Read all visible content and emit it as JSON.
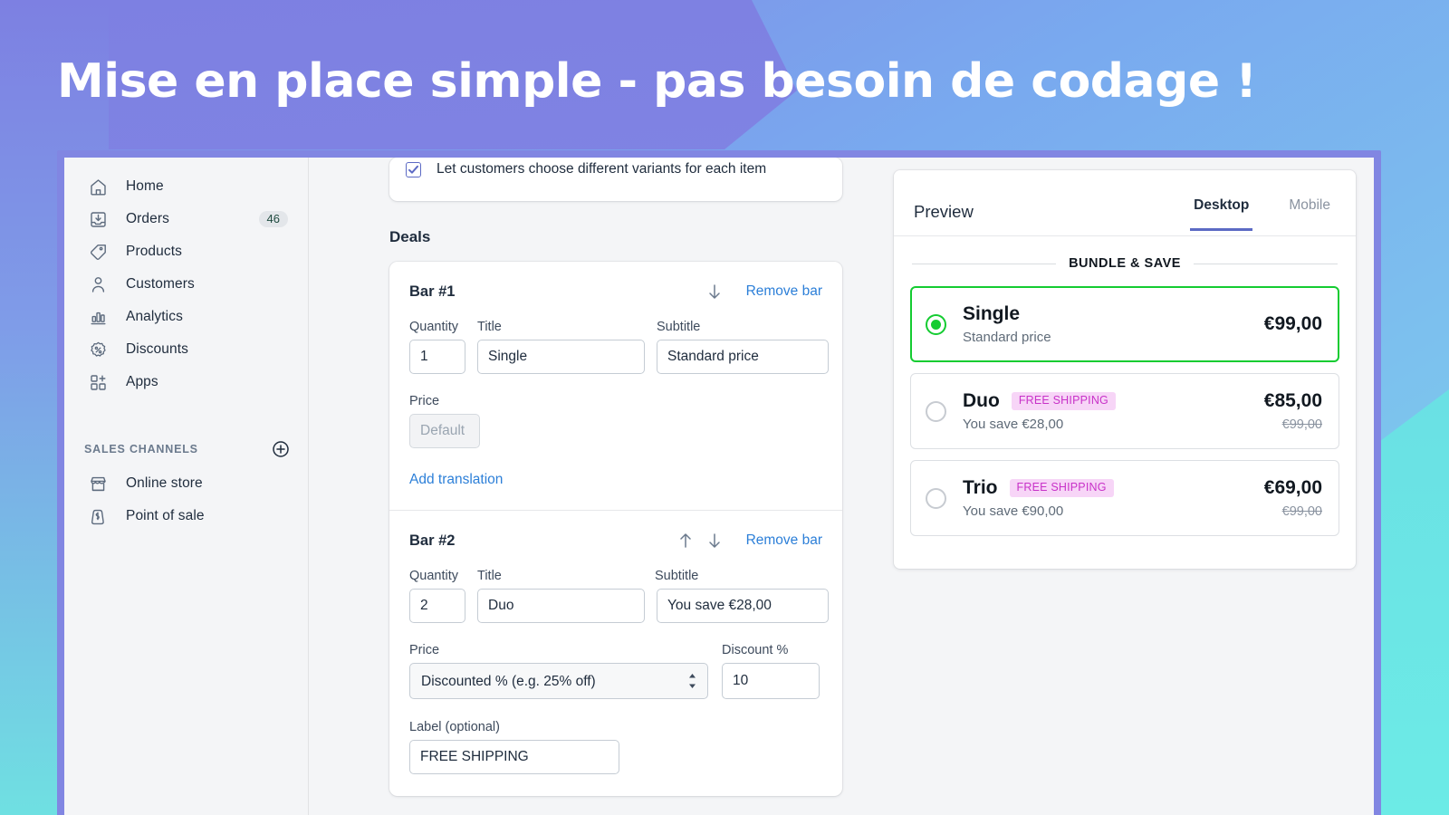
{
  "banner": {
    "headline": "Mise en place simple - pas besoin de codage !",
    "colors": {
      "purple": "#8186e2",
      "blue": "#7db0ee",
      "teal": "#6cebe6"
    }
  },
  "sidebar": {
    "items": [
      {
        "label": "Home",
        "icon": "home-icon",
        "badge": ""
      },
      {
        "label": "Orders",
        "icon": "orders-icon",
        "badge": "46"
      },
      {
        "label": "Products",
        "icon": "products-tag-icon",
        "badge": ""
      },
      {
        "label": "Customers",
        "icon": "customers-person-icon",
        "badge": ""
      },
      {
        "label": "Analytics",
        "icon": "analytics-bars-icon",
        "badge": ""
      },
      {
        "label": "Discounts",
        "icon": "discounts-percent-icon",
        "badge": ""
      },
      {
        "label": "Apps",
        "icon": "apps-grid-plus-icon",
        "badge": ""
      }
    ],
    "section": {
      "title": "SALES CHANNELS",
      "add_icon": "plus-circle-icon",
      "items": [
        {
          "label": "Online store",
          "icon": "online-store-icon"
        },
        {
          "label": "Point of sale",
          "icon": "point-of-sale-icon"
        }
      ]
    }
  },
  "form": {
    "variants_checkbox": {
      "label": "Let customers choose different variants for each item",
      "checked": true
    },
    "deals_heading": "Deals",
    "labels": {
      "quantity": "Quantity",
      "title": "Title",
      "subtitle": "Subtitle",
      "price": "Price",
      "discount_pct": "Discount %",
      "label_optional": "Label (optional)"
    },
    "remove_bar": "Remove bar",
    "add_translation": "Add translation",
    "bars": [
      {
        "name": "Bar #1",
        "quantity": "1",
        "title": "Single",
        "subtitle": "Standard price",
        "price_value": "Default",
        "price_disabled": true,
        "has_up_arrow": false,
        "has_down_arrow": true
      },
      {
        "name": "Bar #2",
        "quantity": "2",
        "title": "Duo",
        "subtitle": "You save €28,00",
        "price_value": "Discounted % (e.g. 25% off)",
        "price_disabled": false,
        "discount_value": "10",
        "label_value": "FREE SHIPPING",
        "has_up_arrow": true,
        "has_down_arrow": true
      }
    ]
  },
  "preview": {
    "title": "Preview",
    "tabs": [
      {
        "label": "Desktop",
        "active": true
      },
      {
        "label": "Mobile",
        "active": false
      }
    ],
    "bundle_title": "BUNDLE & SAVE",
    "options": [
      {
        "name": "Single",
        "badge": "",
        "subtitle": "Standard price",
        "price": "€99,00",
        "old_price": "",
        "selected": true
      },
      {
        "name": "Duo",
        "badge": "FREE SHIPPING",
        "subtitle": "You save €28,00",
        "price": "€85,00",
        "old_price": "€99,00",
        "selected": false
      },
      {
        "name": "Trio",
        "badge": "FREE SHIPPING",
        "subtitle": "You save €90,00",
        "price": "€69,00",
        "old_price": "€99,00",
        "selected": false
      }
    ]
  }
}
